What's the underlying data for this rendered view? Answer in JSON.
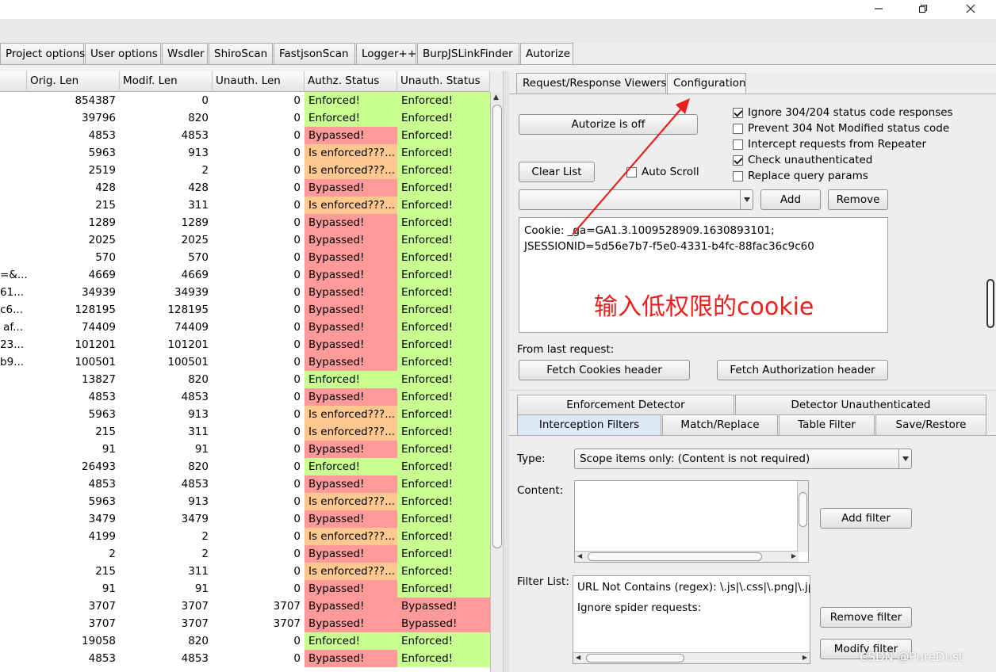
{
  "window": {
    "minimize_icon": "minimize-icon",
    "maximize_icon": "maximize-icon",
    "close_icon": "close-icon"
  },
  "top_tabs": [
    {
      "label": "Project options",
      "active": false
    },
    {
      "label": "User options",
      "active": false
    },
    {
      "label": "Wsdler",
      "active": false
    },
    {
      "label": "ShiroScan",
      "active": false
    },
    {
      "label": "FastjsonScan",
      "active": false
    },
    {
      "label": "Logger++",
      "active": false
    },
    {
      "label": "BurpJSLinkFinder",
      "active": false
    },
    {
      "label": "Autorize",
      "active": true
    }
  ],
  "table": {
    "columns": [
      "",
      "Orig. Len",
      "Modif. Len",
      "Unauth. Len",
      "Authz. Status",
      "Unauth. Status"
    ],
    "rows": [
      [
        "",
        "854387",
        "0",
        "0",
        "Enforced!",
        "Enforced!"
      ],
      [
        "",
        "39796",
        "820",
        "0",
        "Enforced!",
        "Enforced!"
      ],
      [
        "",
        "4853",
        "4853",
        "0",
        "Bypassed!",
        "Enforced!"
      ],
      [
        "",
        "5963",
        "913",
        "0",
        "Is enforced???...",
        "Enforced!"
      ],
      [
        "",
        "2519",
        "2",
        "0",
        "Is enforced???...",
        "Enforced!"
      ],
      [
        "",
        "428",
        "428",
        "0",
        "Bypassed!",
        "Enforced!"
      ],
      [
        "",
        "215",
        "311",
        "0",
        "Is enforced???...",
        "Enforced!"
      ],
      [
        "",
        "1289",
        "1289",
        "0",
        "Bypassed!",
        "Enforced!"
      ],
      [
        "",
        "2025",
        "2025",
        "0",
        "Bypassed!",
        "Enforced!"
      ],
      [
        "",
        "570",
        "570",
        "0",
        "Bypassed!",
        "Enforced!"
      ],
      [
        "=&...",
        "4669",
        "4669",
        "0",
        "Bypassed!",
        "Enforced!"
      ],
      [
        "61...",
        "34939",
        "34939",
        "0",
        "Bypassed!",
        "Enforced!"
      ],
      [
        "c6...",
        "128195",
        "128195",
        "0",
        "Bypassed!",
        "Enforced!"
      ],
      [
        "af...",
        "74409",
        "74409",
        "0",
        "Bypassed!",
        "Enforced!"
      ],
      [
        "23...",
        "101201",
        "101201",
        "0",
        "Bypassed!",
        "Enforced!"
      ],
      [
        "b9...",
        "100501",
        "100501",
        "0",
        "Bypassed!",
        "Enforced!"
      ],
      [
        "",
        "13827",
        "820",
        "0",
        "Enforced!",
        "Enforced!"
      ],
      [
        "",
        "4853",
        "4853",
        "0",
        "Bypassed!",
        "Enforced!"
      ],
      [
        "",
        "5963",
        "913",
        "0",
        "Is enforced???...",
        "Enforced!"
      ],
      [
        "",
        "215",
        "311",
        "0",
        "Is enforced???...",
        "Enforced!"
      ],
      [
        "",
        "91",
        "91",
        "0",
        "Bypassed!",
        "Enforced!"
      ],
      [
        "",
        "26493",
        "820",
        "0",
        "Enforced!",
        "Enforced!"
      ],
      [
        "",
        "4853",
        "4853",
        "0",
        "Bypassed!",
        "Enforced!"
      ],
      [
        "",
        "5963",
        "913",
        "0",
        "Is enforced???...",
        "Enforced!"
      ],
      [
        "",
        "3479",
        "3479",
        "0",
        "Bypassed!",
        "Enforced!"
      ],
      [
        "",
        "4199",
        "2",
        "0",
        "Is enforced???...",
        "Enforced!"
      ],
      [
        "",
        "2",
        "2",
        "0",
        "Bypassed!",
        "Enforced!"
      ],
      [
        "",
        "215",
        "311",
        "0",
        "Is enforced???...",
        "Enforced!"
      ],
      [
        "",
        "91",
        "91",
        "0",
        "Bypassed!",
        "Enforced!"
      ],
      [
        "",
        "3707",
        "3707",
        "3707",
        "Bypassed!",
        "Bypassed!"
      ],
      [
        "",
        "3707",
        "3707",
        "3707",
        "Bypassed!",
        "Bypassed!"
      ],
      [
        "",
        "19058",
        "820",
        "0",
        "Enforced!",
        "Enforced!"
      ],
      [
        "",
        "4853",
        "4853",
        "0",
        "Bypassed!",
        "Enforced!"
      ]
    ]
  },
  "status_colors": {
    "Enforced!": "#c8ff90",
    "Bypassed!": "#ff9a9a",
    "Is enforced???...": "#ffc890"
  },
  "config": {
    "subtabs": [
      {
        "label": "Request/Response Viewers",
        "active": false
      },
      {
        "label": "Configuration",
        "active": true
      }
    ],
    "autorize_button": "Autorize is off",
    "clear_list": "Clear List",
    "auto_scroll": "Auto Scroll",
    "checkboxes": [
      {
        "label": "Ignore 304/204 status code responses",
        "checked": true
      },
      {
        "label": "Prevent 304 Not Modified status code",
        "checked": false
      },
      {
        "label": "Intercept requests from Repeater",
        "checked": false
      },
      {
        "label": "Check unauthenticated",
        "checked": true
      },
      {
        "label": "Replace query params",
        "checked": false
      }
    ],
    "add": "Add",
    "remove": "Remove",
    "cookie_text": "Cookie: _ga=GA1.3.1009528909.1630893101;\nJSESSIONID=5d56e7b7-f5e0-4331-b4fc-88fac36c9c60",
    "annotation": "输入低权限的cookie",
    "annotation_color": "#e8201d",
    "from_last_request": "From last request:",
    "fetch_cookies": "Fetch Cookies header",
    "fetch_auth": "Fetch Authorization header"
  },
  "filters": {
    "tabs_row1": [
      "Enforcement Detector",
      "Detector Unauthenticated"
    ],
    "tabs_row2": [
      {
        "label": "Interception Filters",
        "active": true
      },
      {
        "label": "Match/Replace",
        "active": false
      },
      {
        "label": "Table Filter",
        "active": false
      },
      {
        "label": "Save/Restore",
        "active": false
      }
    ],
    "type_label": "Type:",
    "type_value": "Scope items only: (Content is not required)",
    "content_label": "Content:",
    "add_filter": "Add filter",
    "filter_list_label": "Filter List:",
    "filter_items": [
      "URL Not Contains (regex): \\.js|\\.css|\\.png|\\.jpg|\\.",
      "Ignore spider requests:"
    ],
    "remove_filter": "Remove filter",
    "modify_filter": "Modify filter"
  },
  "watermark": "CSDN @PureDust"
}
